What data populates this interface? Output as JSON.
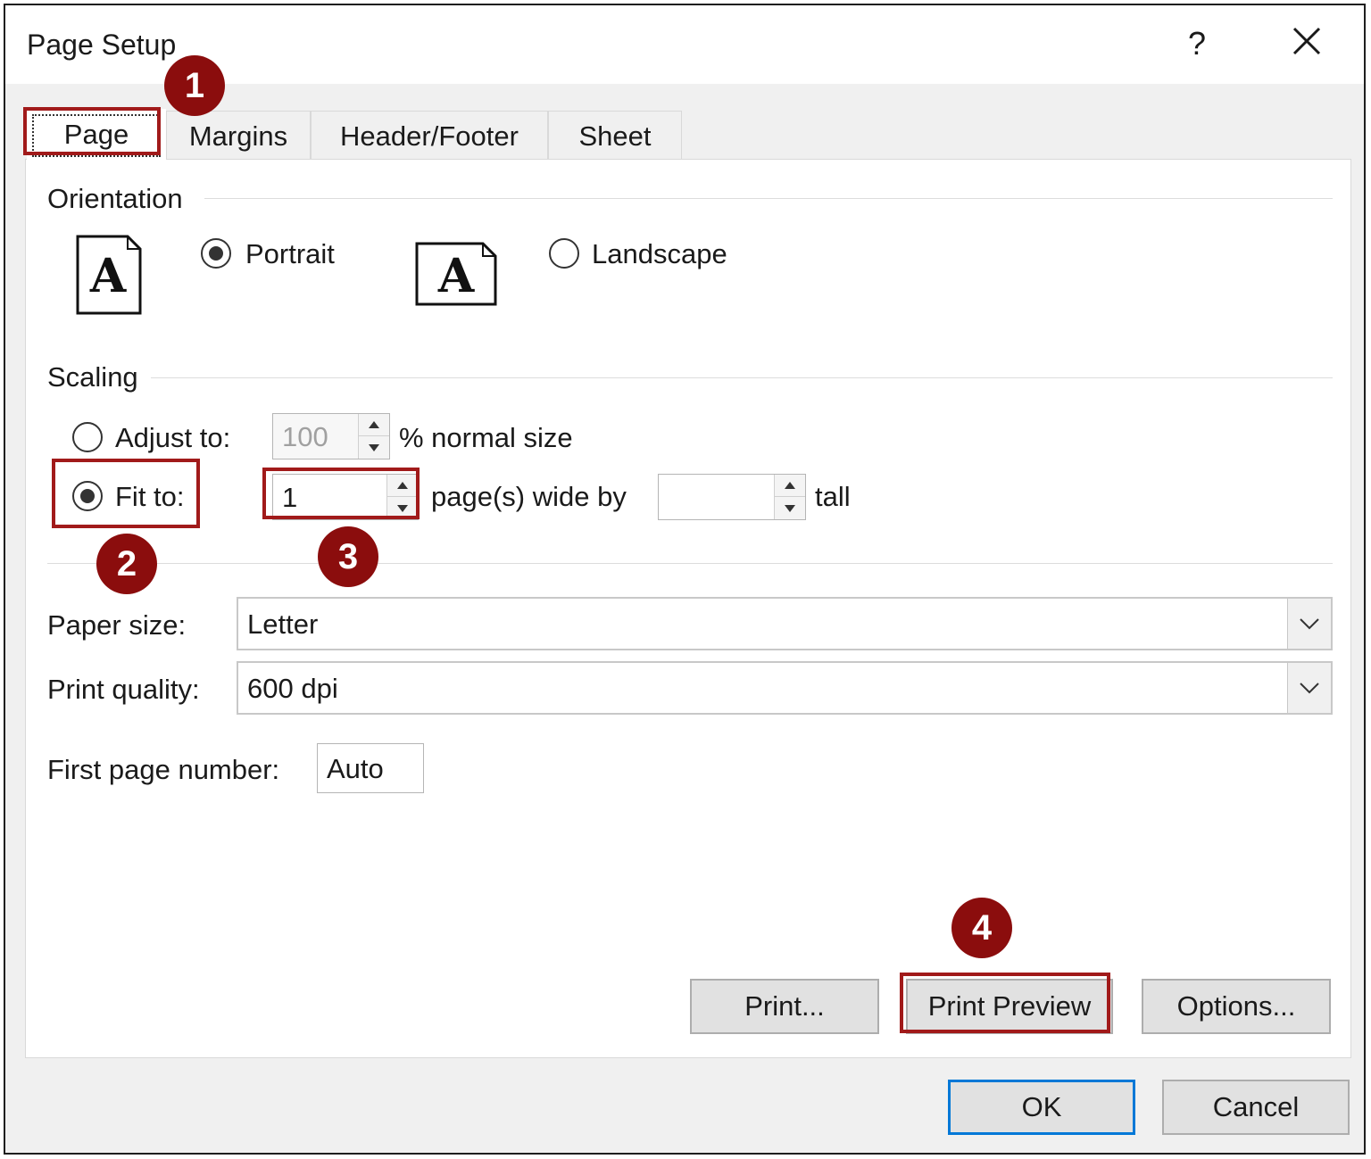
{
  "dialog": {
    "title": "Page Setup",
    "help_glyph": "?",
    "close_glyph": "✕"
  },
  "tabs": [
    {
      "label": "Page",
      "active": true
    },
    {
      "label": "Margins",
      "active": false
    },
    {
      "label": "Header/Footer",
      "active": false
    },
    {
      "label": "Sheet",
      "active": false
    }
  ],
  "orientation": {
    "group_label": "Orientation",
    "icon_letter": "A",
    "portrait_label": "Portrait",
    "landscape_label": "Landscape",
    "selected": "portrait"
  },
  "scaling": {
    "group_label": "Scaling",
    "adjust_label": "Adjust to:",
    "adjust_value": "100",
    "adjust_suffix": "% normal size",
    "fit_label": "Fit to:",
    "wide_value": "1",
    "wide_suffix": "page(s) wide by",
    "tall_value": "",
    "tall_suffix": "tall",
    "selected": "fit"
  },
  "paper": {
    "size_label": "Paper size:",
    "size_value": "Letter",
    "quality_label": "Print quality:",
    "quality_value": "600 dpi",
    "first_page_label": "First page number:",
    "first_page_value": "Auto"
  },
  "buttons": {
    "print": "Print...",
    "print_preview": "Print Preview",
    "options": "Options...",
    "ok": "OK",
    "cancel": "Cancel"
  },
  "annotations": {
    "step1": "1",
    "step2": "2",
    "step3": "3",
    "step4": "4",
    "highlight_color": "#a11a1a",
    "marker_color": "#8b0d0d"
  }
}
